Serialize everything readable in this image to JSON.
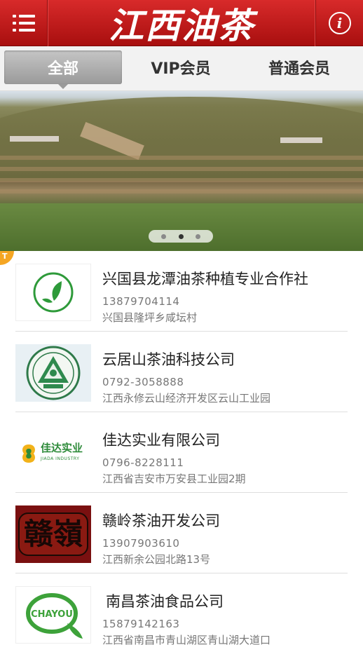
{
  "header": {
    "title": "江西油茶",
    "menu_icon": "menu-icon",
    "info_icon": "info-icon",
    "brand_color": "#c41a1a"
  },
  "tabs": [
    {
      "label": "全部",
      "active": true
    },
    {
      "label": "VIP会员",
      "active": false
    },
    {
      "label": "普通会员",
      "active": false
    }
  ],
  "banner": {
    "slide_count": 3,
    "active_slide": 2
  },
  "top_badge": "T",
  "companies": [
    {
      "name": "兴国县龙潭油茶种植专业合作社",
      "phone": "13879704114",
      "address": "兴国县隆坪乡咸坛村",
      "logo": "green-leaf-logo"
    },
    {
      "name": "云居山茶油科技公司",
      "phone": "0792-3058888",
      "address": "江西永修云山经济开发区云山工业园",
      "logo": "yunjushan-triangle-logo"
    },
    {
      "name": "佳达实业有限公司",
      "phone": "0796-8228111",
      "address": "江西省吉安市万安县工业园2期",
      "logo": "jiada-industry-logo",
      "logo_text": "佳达实业",
      "logo_subtext": "JIADA INDUSTRY"
    },
    {
      "name": "赣岭茶油开发公司",
      "phone": "13907903610",
      "address": "江西新余公园北路13号",
      "logo": "ganling-calligraphy-logo",
      "logo_text": "赣嶺"
    },
    {
      "name": "南昌茶油食品公司",
      "phone": "15879142163",
      "address": "江西省南昌市青山湖区青山湖大道口",
      "logo": "chayou-leaf-logo",
      "logo_text": "CHAYOU"
    }
  ]
}
